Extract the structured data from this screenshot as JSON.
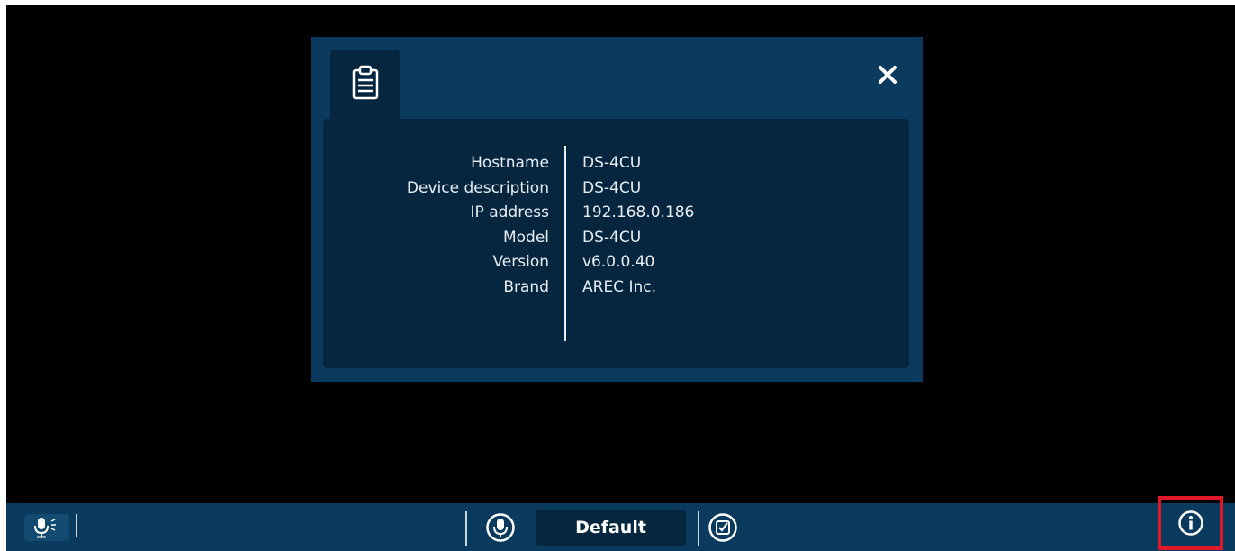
{
  "dialog": {
    "tab_icon": "clipboard-list-icon",
    "close_icon": "close-icon",
    "info": [
      {
        "label": "Hostname",
        "value": "DS-4CU"
      },
      {
        "label": "Device description",
        "value": "DS-4CU"
      },
      {
        "label": "IP address",
        "value": "192.168.0.186"
      },
      {
        "label": "Model",
        "value": "DS-4CU"
      },
      {
        "label": "Version",
        "value": "v6.0.0.40"
      },
      {
        "label": "Brand",
        "value": "AREC Inc."
      }
    ]
  },
  "bottom_bar": {
    "mic_speaker_icon": "mic-sound-icon",
    "mic_icon": "microphone-circle-icon",
    "preset_label": "Default",
    "check_icon": "checkbox-circle-icon",
    "info_icon": "info-circle-icon"
  },
  "colors": {
    "panel": "#0a3a5e",
    "panel_dark": "#06263f",
    "text": "#e8eef3",
    "highlight": "#e0182a"
  }
}
